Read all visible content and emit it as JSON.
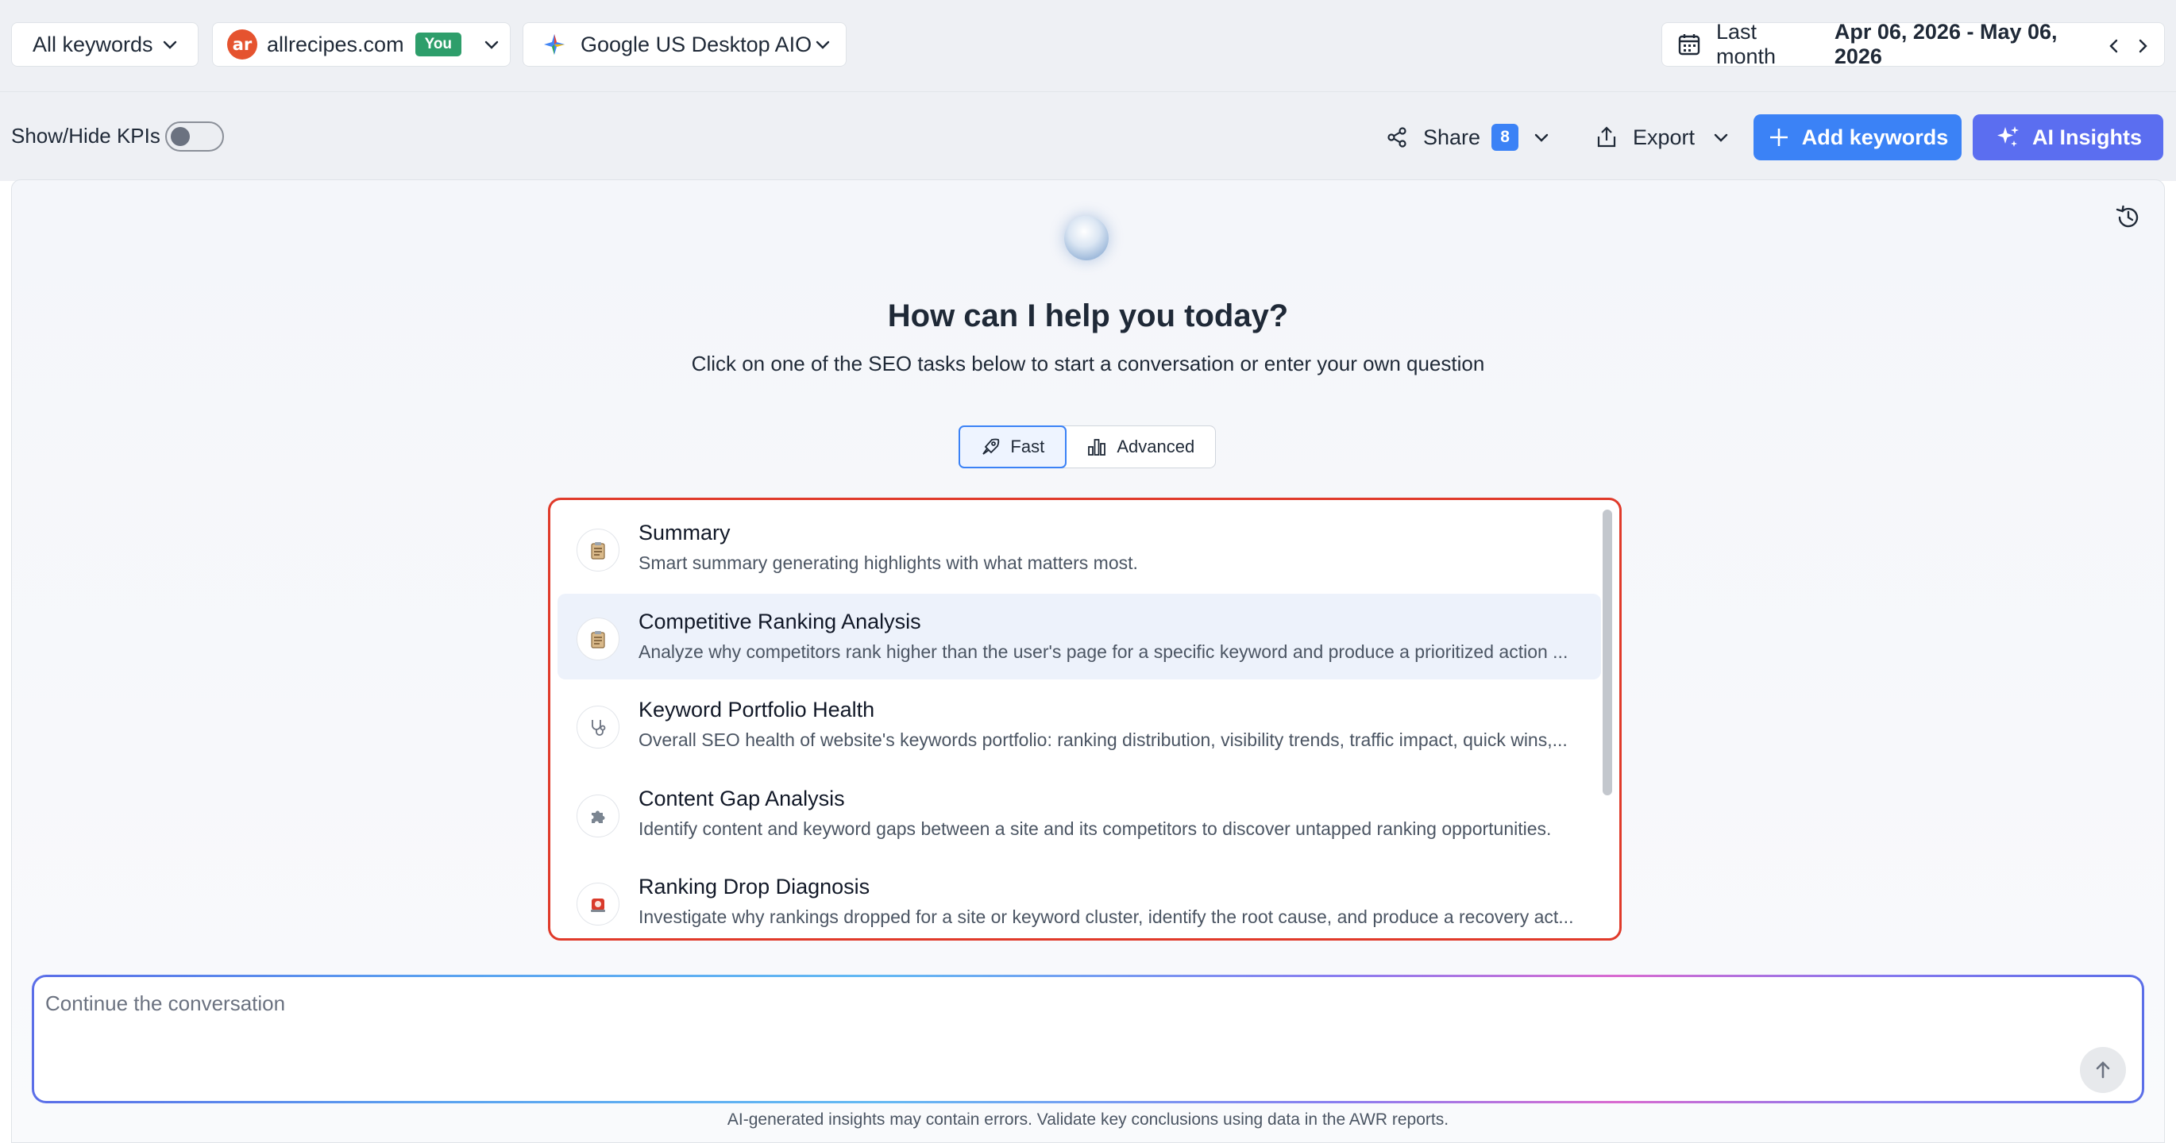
{
  "topbar": {
    "keywords_filter": "All keywords",
    "site": {
      "logo_text": "ar",
      "name": "allrecipes.com",
      "badge": "You"
    },
    "engine": "Google US Desktop AIO",
    "date": {
      "period": "Last month",
      "range": "Apr 06, 2026 - May 06, 2026"
    }
  },
  "toolbar": {
    "kpi_label": "Show/Hide KPIs",
    "share_label": "Share",
    "share_count": "8",
    "export_label": "Export",
    "add_keywords_label": "Add keywords",
    "ai_insights_label": "AI Insights"
  },
  "assistant": {
    "heading": "How can I help you today?",
    "subheading": "Click on one of the SEO tasks below to start a conversation or enter your own question",
    "modes": {
      "fast": "Fast",
      "advanced": "Advanced",
      "selected": "Fast"
    },
    "tasks": [
      {
        "icon": "clipboard-icon",
        "title": "Summary",
        "desc": "Smart summary generating highlights with what matters most."
      },
      {
        "icon": "clipboard-icon",
        "title": "Competitive Ranking Analysis",
        "desc": "Analyze why competitors rank higher than the user's page for a specific keyword and produce a prioritized action ..."
      },
      {
        "icon": "stethoscope-icon",
        "title": "Keyword Portfolio Health",
        "desc": "Overall SEO health of website's keywords portfolio: ranking distribution, visibility trends, traffic impact, quick wins,..."
      },
      {
        "icon": "puzzle-icon",
        "title": "Content Gap Analysis",
        "desc": "Identify content and keyword gaps between a site and its competitors to discover untapped ranking opportunities."
      },
      {
        "icon": "siren-icon",
        "title": "Ranking Drop Diagnosis",
        "desc": "Investigate why rankings dropped for a site or keyword cluster, identify the root cause, and produce a recovery act..."
      }
    ],
    "input_placeholder": "Continue the conversation",
    "disclaimer": "AI-generated insights may contain errors. Validate key conclusions using data in the AWR reports."
  },
  "colors": {
    "accent_blue": "#3b82f6",
    "ai_purple": "#5b6ef0",
    "highlight_red": "#e03a2a",
    "badge_green": "#2e9e6b"
  }
}
